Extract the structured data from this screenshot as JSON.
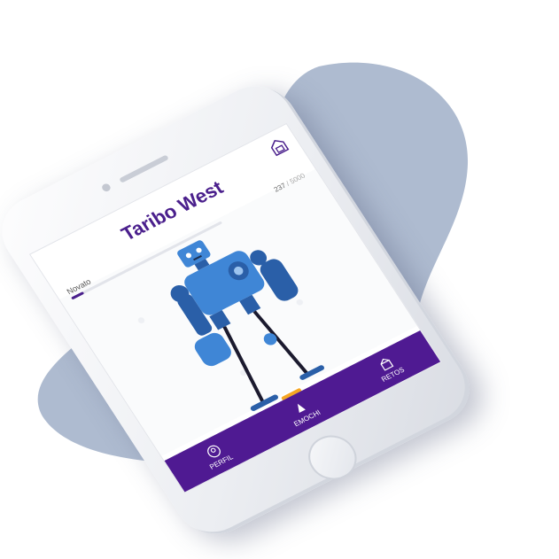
{
  "app": {
    "character_name": "Taribo West",
    "level_label": "Novato",
    "xp_current": "237",
    "xp_separator": " / ",
    "xp_max": "5000",
    "progress_fraction": 0.0474
  },
  "navbar": {
    "items": [
      {
        "label": "PERFIL",
        "icon": "profile-icon"
      },
      {
        "label": "EMOCHI",
        "icon": "emochi-icon"
      },
      {
        "label": "RETOS",
        "icon": "challenges-icon"
      }
    ],
    "active_index": 1
  },
  "colors": {
    "brand_purple": "#4f1a92",
    "title_purple": "#4a1f8c",
    "robot_blue": "#3f86d6",
    "robot_dark": "#2a5fa8",
    "indicator": "#f5a623",
    "blob": "#aebbd0"
  }
}
